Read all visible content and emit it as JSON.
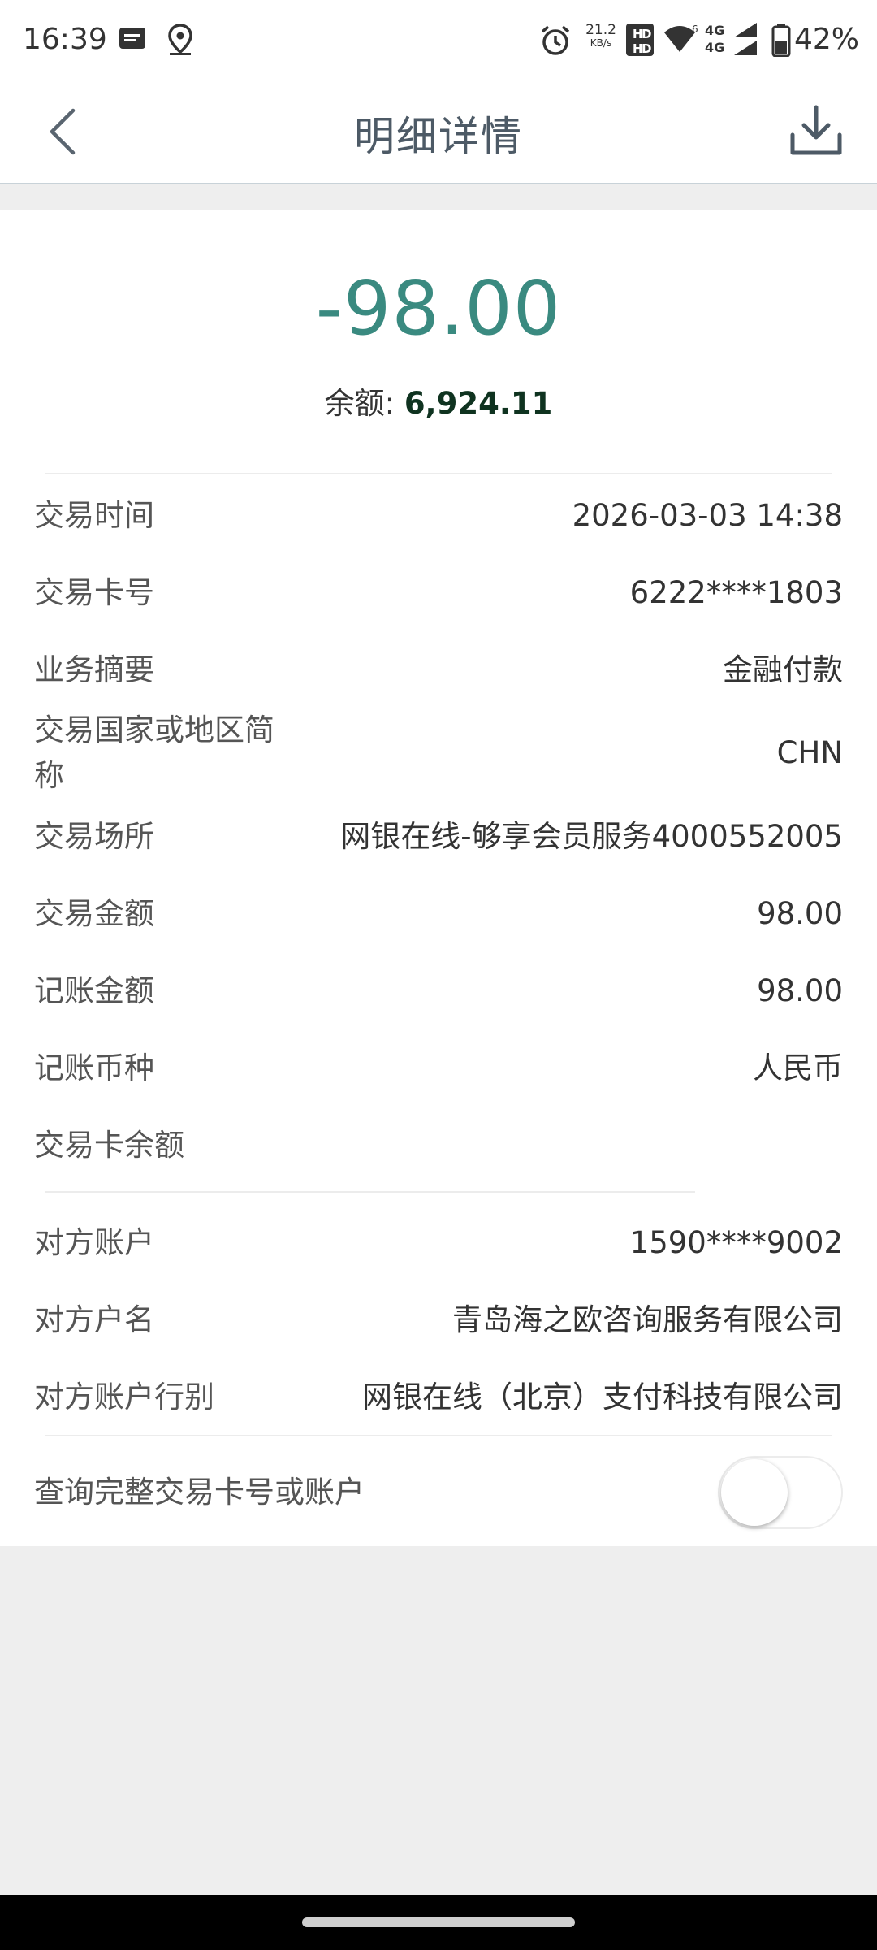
{
  "status_bar": {
    "time": "16:39",
    "speed_value": "21.2",
    "speed_unit": "KB/s",
    "battery": "42%",
    "icons": [
      "message-icon",
      "location-icon",
      "alarm-icon",
      "data-speed-icon",
      "hd-icon",
      "wifi-icon",
      "signal-4g-icon",
      "battery-icon"
    ]
  },
  "nav": {
    "title": "明细详情",
    "back_icon": "chevron-left-icon",
    "download_icon": "download-icon"
  },
  "summary": {
    "amount": "-98.00",
    "balance_label": "余额: ",
    "balance_value": "6,924.11"
  },
  "details": [
    {
      "label": "交易时间",
      "value": "2026-03-03 14:38"
    },
    {
      "label": "交易卡号",
      "value": "6222****1803"
    },
    {
      "label": "业务摘要",
      "value": "金融付款"
    },
    {
      "label_line1": "交易国家或地区简",
      "label_line2": "称",
      "value": "CHN"
    },
    {
      "label": "交易场所",
      "value": "网银在线-够享会员服务4000552005"
    },
    {
      "label": "交易金额",
      "value": "98.00"
    },
    {
      "label": "记账金额",
      "value": "98.00"
    },
    {
      "label": "记账币种",
      "value": "人民币"
    },
    {
      "label": "交易卡余额",
      "value": ""
    }
  ],
  "counterparty": [
    {
      "label": "对方账户",
      "value": "1590****9002"
    },
    {
      "label": "对方户名",
      "value": "青岛海之欧咨询服务有限公司"
    },
    {
      "label": "对方账户行别",
      "value": "网银在线（北京）支付科技有限公司"
    }
  ],
  "query_toggle": {
    "label": "查询完整交易卡号或账户",
    "state": "off"
  },
  "colors": {
    "amount": "#3a8a80",
    "balance_value": "#0f3320",
    "nav_title": "#4d5a66"
  }
}
